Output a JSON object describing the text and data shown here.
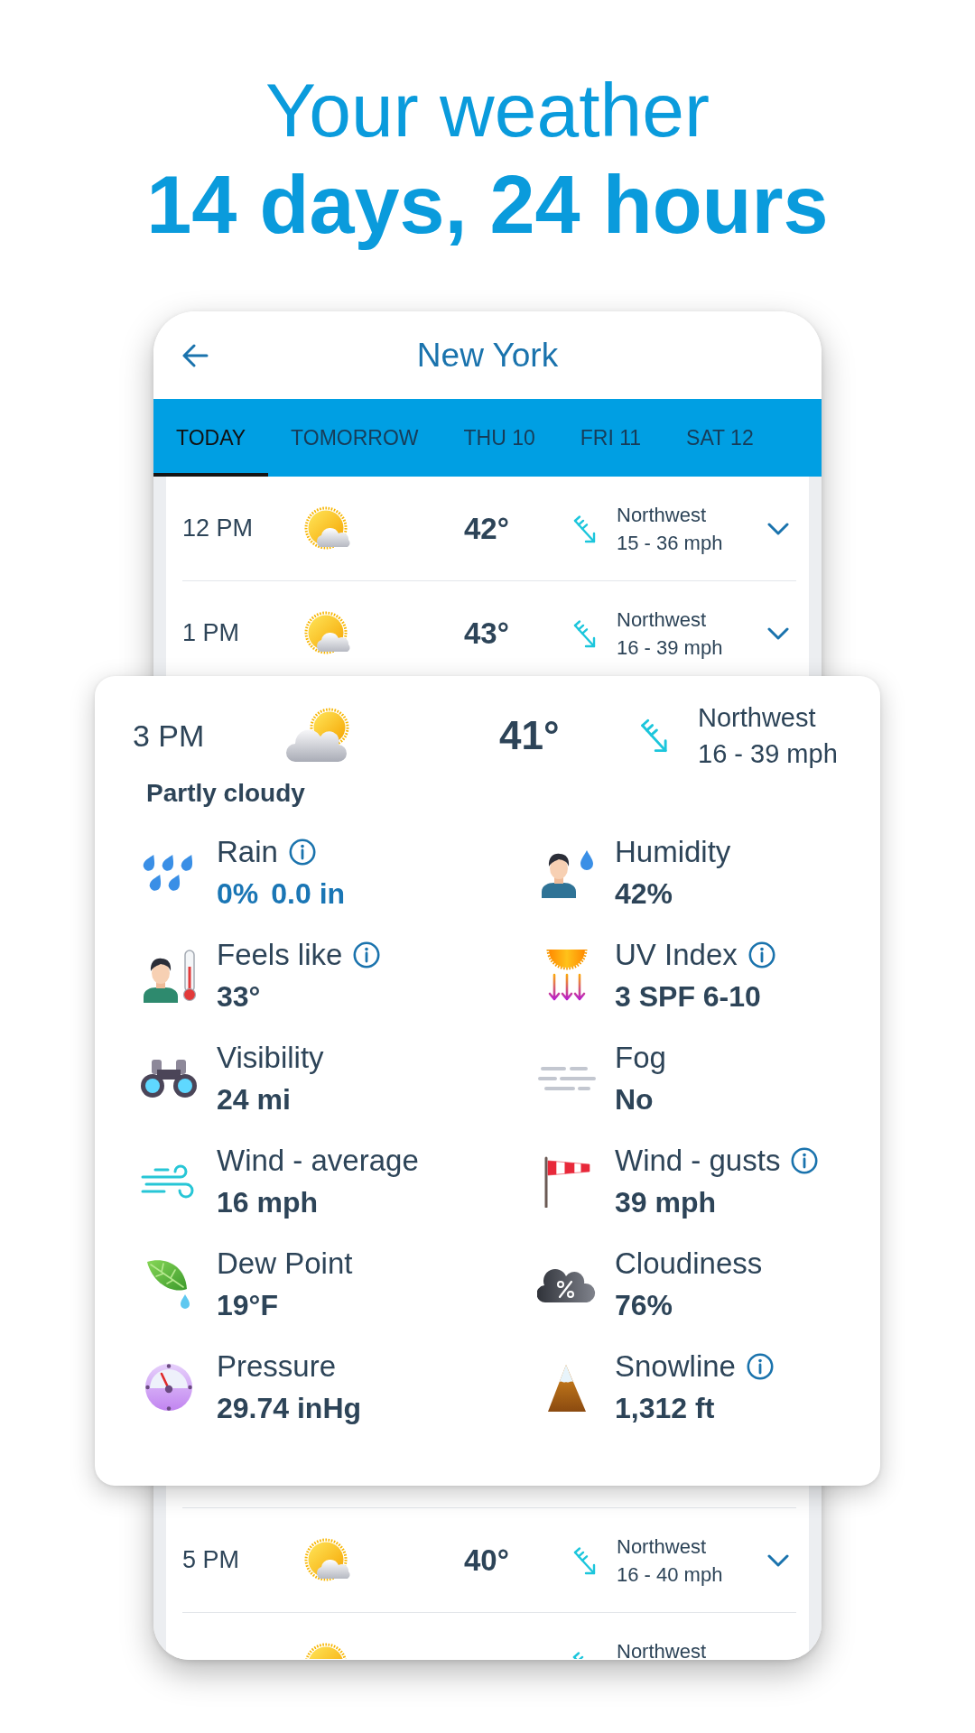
{
  "headline": {
    "line_1": "Your weather",
    "line_2": "14 days, 24 hours"
  },
  "app": {
    "title": "New York",
    "tabs": [
      {
        "label": "TODAY",
        "selected": true
      },
      {
        "label": "TOMORROW",
        "selected": false
      },
      {
        "label": "THU 10",
        "selected": false
      },
      {
        "label": "FRI 11",
        "selected": false
      },
      {
        "label": "SAT 12",
        "selected": false
      }
    ],
    "hours_above": [
      {
        "kind": "full",
        "time": "12 PM",
        "temperature": "42°",
        "wind_direction": "Northwest",
        "wind_speed": "15 - 36 mph"
      },
      {
        "kind": "full",
        "time": "1 PM",
        "temperature": "43°",
        "wind_direction": "Northwest",
        "wind_speed": "16 - 39 mph"
      }
    ],
    "hours_below": [
      {
        "kind": "full",
        "time": "5 PM",
        "temperature": "40°",
        "wind_direction": "Northwest",
        "wind_speed": "16 - 40 mph"
      },
      {
        "kind": "partial",
        "wind_direction": "Northwest"
      }
    ]
  },
  "detail": {
    "time": "3 PM",
    "temperature": "41°",
    "wind_direction": "Northwest",
    "wind_speed": "16 - 39 mph",
    "condition": "Partly cloudy",
    "metrics": [
      {
        "kind": "rain",
        "label": "Rain",
        "info": true,
        "values": [
          "0%",
          "0.0 in"
        ]
      },
      {
        "kind": "humidity",
        "label": "Humidity",
        "info": false,
        "values": [
          "42%"
        ]
      },
      {
        "kind": "feels",
        "label": "Feels like",
        "info": true,
        "values": [
          "33°"
        ]
      },
      {
        "kind": "uv",
        "label": "UV Index",
        "info": true,
        "values": [
          "3 SPF 6-10"
        ]
      },
      {
        "kind": "visibility",
        "label": "Visibility",
        "info": false,
        "values": [
          "24 mi"
        ]
      },
      {
        "kind": "fog",
        "label": "Fog",
        "info": false,
        "values": [
          "No"
        ]
      },
      {
        "kind": "wind",
        "label": "Wind - average",
        "info": false,
        "values": [
          "16 mph"
        ]
      },
      {
        "kind": "gusts",
        "label": "Wind - gusts",
        "info": true,
        "values": [
          "39 mph"
        ]
      },
      {
        "kind": "dew",
        "label": "Dew Point",
        "info": false,
        "values": [
          "19°F"
        ]
      },
      {
        "kind": "cloudiness",
        "label": "Cloudiness",
        "info": false,
        "values": [
          "76%"
        ]
      },
      {
        "kind": "pressure",
        "label": "Pressure",
        "info": false,
        "values": [
          "29.74 inHg"
        ]
      },
      {
        "kind": "snowline",
        "label": "Snowline",
        "info": true,
        "values": [
          "1,312 ft"
        ]
      }
    ]
  }
}
